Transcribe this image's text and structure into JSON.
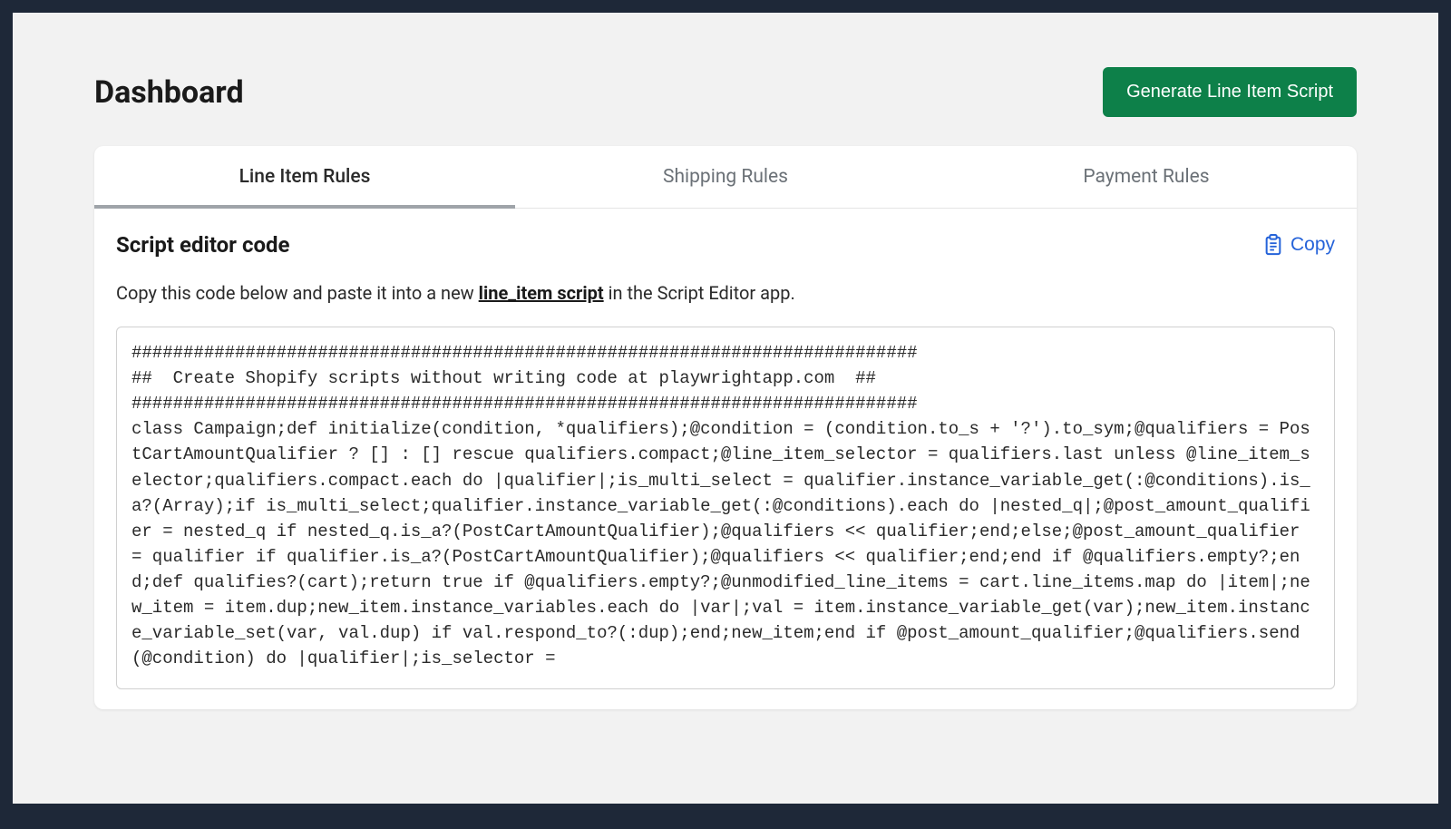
{
  "header": {
    "page_title": "Dashboard",
    "generate_button": "Generate Line Item Script"
  },
  "tabs": {
    "line_item": "Line Item Rules",
    "shipping": "Shipping Rules",
    "payment": "Payment Rules"
  },
  "section": {
    "title": "Script editor code",
    "copy_label": "Copy",
    "instruction_prefix": "Copy this code below and paste it into a new ",
    "instruction_link": "line_item script",
    "instruction_suffix": " in the Script Editor app."
  },
  "code": "############################################################################\n##  Create Shopify scripts without writing code at playwrightapp.com  ##\n############################################################################\nclass Campaign;def initialize(condition, *qualifiers);@condition = (condition.to_s + '?').to_sym;@qualifiers = PostCartAmountQualifier ? [] : [] rescue qualifiers.compact;@line_item_selector = qualifiers.last unless @line_item_selector;qualifiers.compact.each do |qualifier|;is_multi_select = qualifier.instance_variable_get(:@conditions).is_a?(Array);if is_multi_select;qualifier.instance_variable_get(:@conditions).each do |nested_q|;@post_amount_qualifier = nested_q if nested_q.is_a?(PostCartAmountQualifier);@qualifiers << qualifier;end;else;@post_amount_qualifier = qualifier if qualifier.is_a?(PostCartAmountQualifier);@qualifiers << qualifier;end;end if @qualifiers.empty?;end;def qualifies?(cart);return true if @qualifiers.empty?;@unmodified_line_items = cart.line_items.map do |item|;new_item = item.dup;new_item.instance_variables.each do |var|;val = item.instance_variable_get(var);new_item.instance_variable_set(var, val.dup) if val.respond_to?(:dup);end;new_item;end if @post_amount_qualifier;@qualifiers.send(@condition) do |qualifier|;is_selector ="
}
